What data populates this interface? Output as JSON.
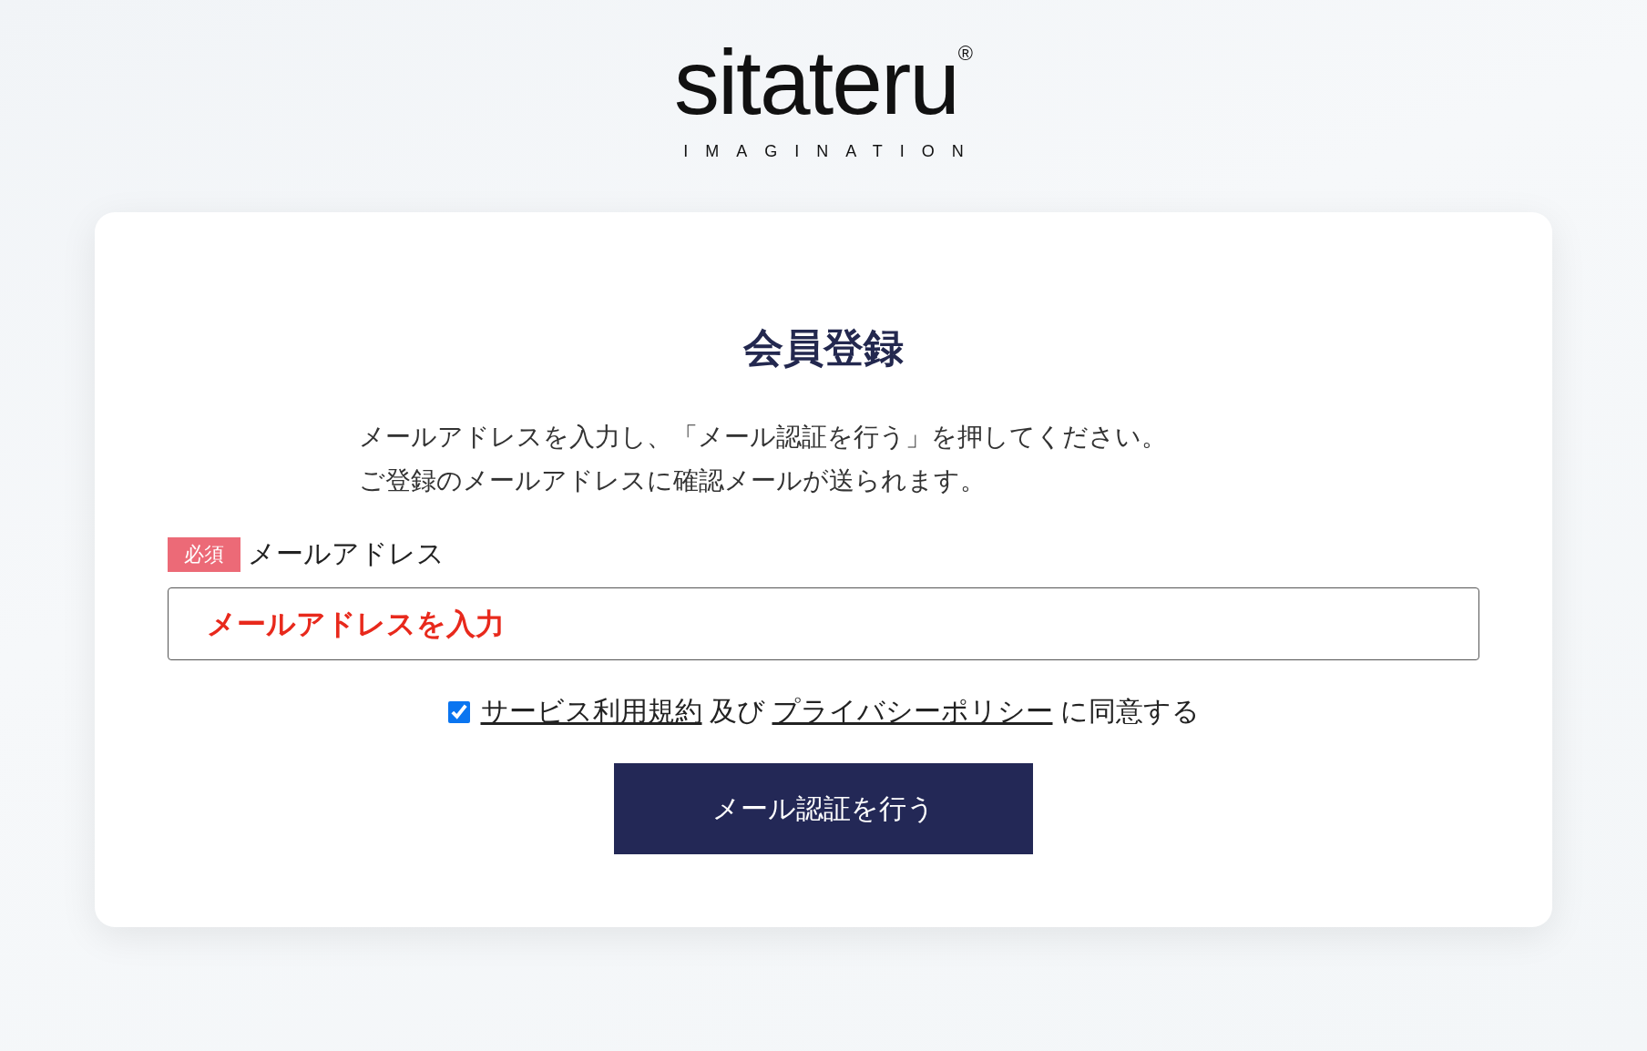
{
  "logo": {
    "wordmark": "sitateru",
    "registered_mark": "®",
    "tagline": "IMAGINATION"
  },
  "form": {
    "title": "会員登録",
    "description": [
      "メールアドレスを入力し、「メール認証を行う」を押してください。",
      "ご登録のメールアドレスに確認メールが送られます。"
    ],
    "field": {
      "required_badge": "必須",
      "label": "メールアドレス",
      "placeholder": "メールアドレスを入力"
    },
    "agreement": {
      "checked": true,
      "terms_link": "サービス利用規約",
      "conjunction": "及び",
      "privacy_link": "プライバシーポリシー",
      "suffix": "に同意する"
    },
    "submit_button": "メール認証を行う"
  }
}
